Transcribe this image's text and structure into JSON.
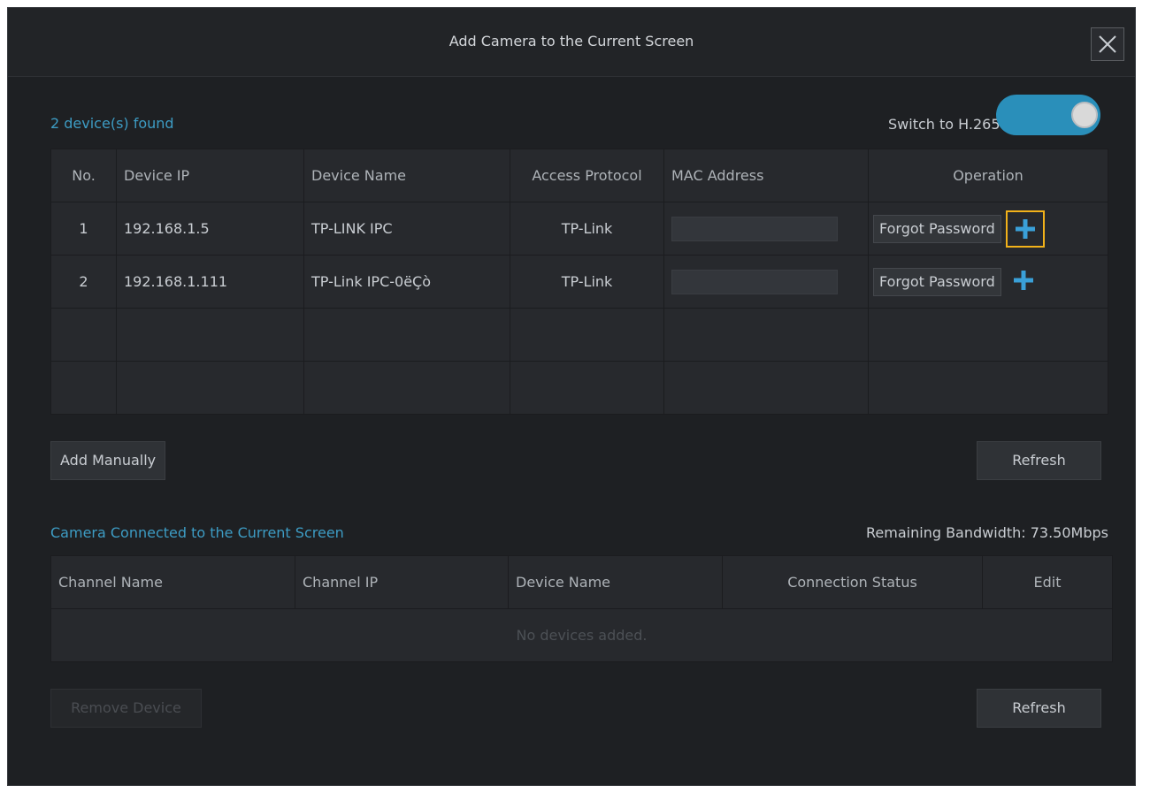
{
  "dialog": {
    "title": "Add Camera to the Current Screen"
  },
  "found": {
    "label": "2 device(s) found",
    "h265_label": "Switch to H.265",
    "h265_enabled": true,
    "columns": [
      "No.",
      "Device IP",
      "Device Name",
      "Access Protocol",
      "MAC Address",
      "Operation"
    ],
    "rows": [
      {
        "no": "1",
        "ip": "192.168.1.5",
        "name": "TP-LINK IPC",
        "protocol": "TP-Link",
        "mac": "",
        "action": "Forgot Password"
      },
      {
        "no": "2",
        "ip": "192.168.1.111",
        "name": "TP-Link IPC-0ëÇò",
        "protocol": "TP-Link",
        "mac": "",
        "action": "Forgot Password"
      }
    ],
    "add_manually": "Add Manually",
    "refresh": "Refresh"
  },
  "connected": {
    "label": "Camera Connected to the Current Screen",
    "bandwidth": "Remaining Bandwidth: 73.50Mbps",
    "columns": [
      "Channel Name",
      "Channel IP",
      "Device Name",
      "Connection Status",
      "Edit"
    ],
    "empty": "No devices added.",
    "remove": "Remove Device",
    "refresh": "Refresh"
  },
  "colors": {
    "accent": "#2a8fba",
    "highlight": "#f2b21a",
    "background": "#1e2023"
  },
  "icons": {
    "close": "close-icon",
    "add": "plus-icon"
  }
}
